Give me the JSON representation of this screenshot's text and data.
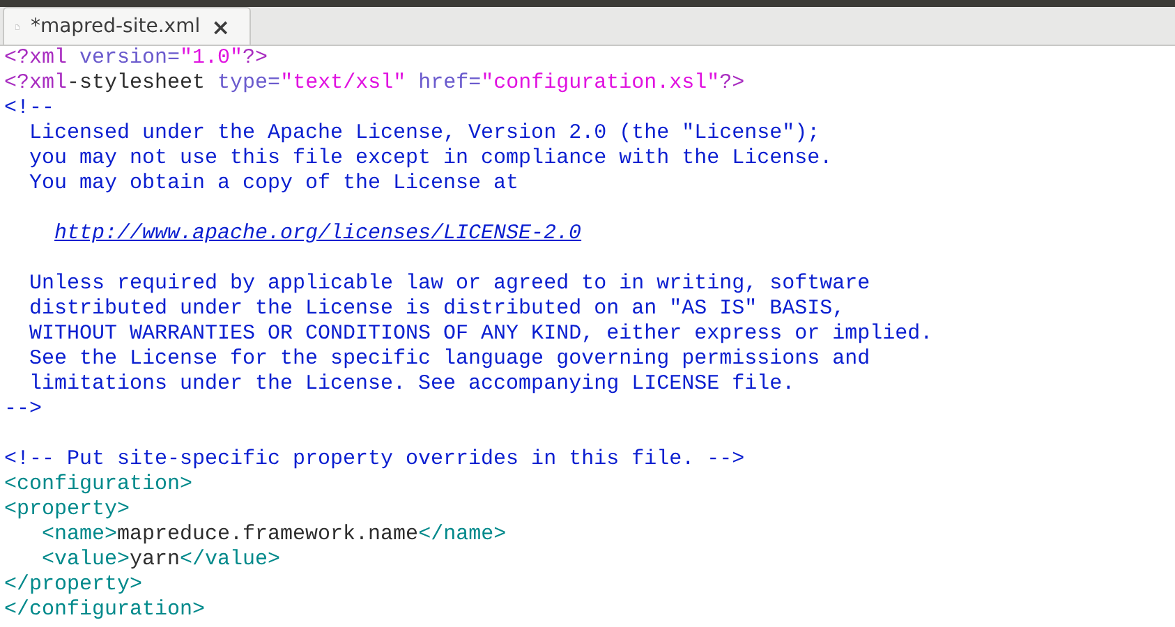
{
  "tab": {
    "title": "*mapred-site.xml",
    "close": "×",
    "selected": true
  },
  "lines": [
    {
      "kind": "code",
      "tokens": [
        {
          "kind": "pi",
          "text": "<?xml "
        },
        {
          "kind": "attr",
          "text": "version="
        },
        {
          "kind": "string",
          "text": "\"1.0\""
        },
        {
          "kind": "pi",
          "text": "?>"
        }
      ]
    },
    {
      "kind": "code",
      "tokens": [
        {
          "kind": "pi",
          "text": "<?xml"
        },
        {
          "kind": "text",
          "text": "-stylesheet "
        },
        {
          "kind": "attr",
          "text": "type="
        },
        {
          "kind": "string",
          "text": "\"text/xsl\" "
        },
        {
          "kind": "attr",
          "text": "href="
        },
        {
          "kind": "string",
          "text": "\"configuration.xsl\""
        },
        {
          "kind": "pi",
          "text": "?>"
        }
      ]
    },
    {
      "kind": "code",
      "tokens": [
        {
          "kind": "comment",
          "text": "<!--"
        }
      ]
    },
    {
      "kind": "code",
      "tokens": [
        {
          "kind": "comment",
          "text": "  Licensed under the Apache License, Version 2.0 (the \"License\");"
        }
      ]
    },
    {
      "kind": "code",
      "tokens": [
        {
          "kind": "comment",
          "text": "  you may not use this file except in compliance with the License."
        }
      ]
    },
    {
      "kind": "code",
      "tokens": [
        {
          "kind": "comment",
          "text": "  You may obtain a copy of the License at"
        }
      ]
    },
    {
      "kind": "blank"
    },
    {
      "kind": "url",
      "tokens": [
        {
          "kind": "link",
          "text": "http://www.apache.org/licenses/LICENSE-2.0"
        }
      ]
    },
    {
      "kind": "blank"
    },
    {
      "kind": "code",
      "tokens": [
        {
          "kind": "comment",
          "text": "  Unless required by applicable law or agreed to in writing, software"
        }
      ]
    },
    {
      "kind": "code",
      "tokens": [
        {
          "kind": "comment",
          "text": "  distributed under the License is distributed on an \"AS IS\" BASIS,"
        }
      ]
    },
    {
      "kind": "code",
      "tokens": [
        {
          "kind": "comment",
          "text": "  WITHOUT WARRANTIES OR CONDITIONS OF ANY KIND, either express or implied."
        }
      ]
    },
    {
      "kind": "code",
      "tokens": [
        {
          "kind": "comment",
          "text": "  See the License for the specific language governing permissions and"
        }
      ]
    },
    {
      "kind": "code",
      "tokens": [
        {
          "kind": "comment",
          "text": "  limitations under the License. See accompanying LICENSE file."
        }
      ]
    },
    {
      "kind": "code",
      "tokens": [
        {
          "kind": "comment",
          "text": "-->"
        }
      ]
    },
    {
      "kind": "blank"
    },
    {
      "kind": "code",
      "tokens": [
        {
          "kind": "comment",
          "text": "<!-- Put site-specific property overrides in this file. -->"
        }
      ]
    },
    {
      "kind": "code",
      "tokens": [
        {
          "kind": "tag",
          "text": "<configuration>"
        }
      ]
    },
    {
      "kind": "code",
      "tokens": [
        {
          "kind": "tag",
          "text": "<property>"
        }
      ]
    },
    {
      "kind": "nested",
      "tokens": [
        {
          "kind": "tag",
          "text": "<name>"
        },
        {
          "kind": "text",
          "text": "mapreduce.framework.name"
        },
        {
          "kind": "tag",
          "text": "</name>"
        }
      ]
    },
    {
      "kind": "nested",
      "tokens": [
        {
          "kind": "tag",
          "text": "<value>"
        },
        {
          "kind": "text",
          "text": "yarn"
        },
        {
          "kind": "tag",
          "text": "</value>"
        }
      ]
    },
    {
      "kind": "code",
      "tokens": [
        {
          "kind": "tag",
          "text": "</property>"
        }
      ]
    },
    {
      "kind": "code",
      "tokens": [
        {
          "kind": "tag",
          "text": "</configuration>"
        }
      ]
    }
  ]
}
